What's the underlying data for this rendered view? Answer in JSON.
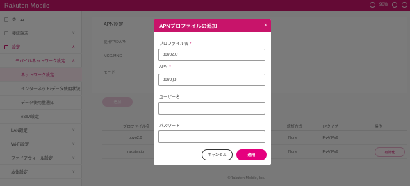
{
  "header": {
    "brand": "Rakuten Mobile",
    "battery": "90%"
  },
  "sidebar": {
    "items": [
      {
        "label": "ホーム",
        "icon": "home-icon"
      },
      {
        "label": "接続端末",
        "icon": "devices-icon"
      },
      {
        "label": "設定",
        "icon": "settings-icon"
      },
      {
        "label": "モバイルネットワーク設定"
      },
      {
        "label": "ネットワーク設定"
      },
      {
        "label": "インターネット/データ使用状況"
      },
      {
        "label": "データ使用量通知"
      },
      {
        "label": "eSIM設定"
      },
      {
        "label": "LAN設定"
      },
      {
        "label": "Wi-Fi設定"
      },
      {
        "label": "ファイアウォール設定"
      },
      {
        "label": "本体設定"
      }
    ]
  },
  "main": {
    "page_title": "APN設定",
    "info_labels": [
      "使用中のAPN",
      "MCC/MNC",
      "モード"
    ],
    "add_button": "追加",
    "table": {
      "headers": [
        "プロファイル名",
        "認証方式",
        "IPタイプ",
        "操作"
      ],
      "rows": [
        {
          "name": "povo2.0",
          "auth": "None",
          "ip": "IPv4/IPv6",
          "action": ""
        },
        {
          "name": "rakuten.jp",
          "auth": "None",
          "ip": "IPv4/IPv6",
          "action": "有効化"
        }
      ]
    },
    "footer": "©Rakuten Mobile, Inc."
  },
  "modal": {
    "title": "APNプロファイルの追加",
    "close_symbol": "×",
    "required_mark": "*",
    "fields": {
      "profile_name": {
        "label": "プロファイル名",
        "value": "povo2.0"
      },
      "apn": {
        "label": "APN",
        "value": "povo.jp"
      },
      "username": {
        "label": "ユーザー名",
        "value": ""
      },
      "password": {
        "label": "パスワード",
        "value": ""
      }
    },
    "cancel_label": "キャンセル",
    "apply_label": "適用"
  },
  "colors": {
    "brand": "#c8146a",
    "primary_button": "#e5007e"
  }
}
